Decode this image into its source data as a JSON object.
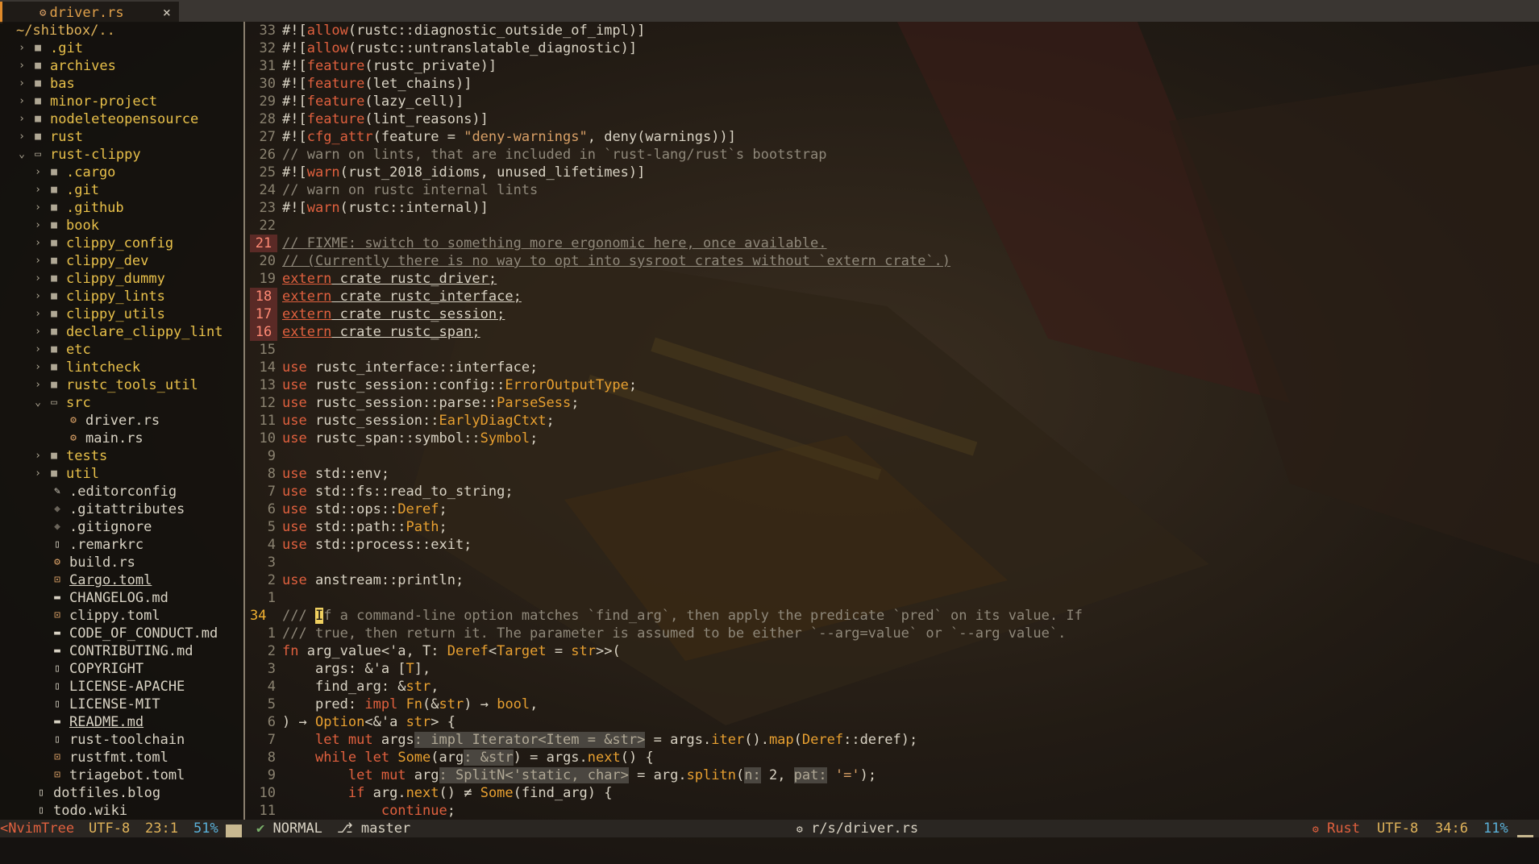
{
  "tab": {
    "icon": "rust-icon",
    "name": "driver.rs",
    "close": "×"
  },
  "tree": {
    "root": "~/shitbox/..",
    "items": [
      {
        "depth": 1,
        "type": "dir",
        "open": false,
        "name": ".git"
      },
      {
        "depth": 1,
        "type": "dir",
        "open": false,
        "name": "archives"
      },
      {
        "depth": 1,
        "type": "dir",
        "open": false,
        "name": "bas"
      },
      {
        "depth": 1,
        "type": "dir",
        "open": false,
        "name": "minor-project"
      },
      {
        "depth": 1,
        "type": "dir",
        "open": false,
        "name": "nodeleteopensource"
      },
      {
        "depth": 1,
        "type": "dir",
        "open": false,
        "name": "rust"
      },
      {
        "depth": 1,
        "type": "dir",
        "open": true,
        "name": "rust-clippy"
      },
      {
        "depth": 2,
        "type": "dir",
        "open": false,
        "name": ".cargo"
      },
      {
        "depth": 2,
        "type": "dir",
        "open": false,
        "name": ".git"
      },
      {
        "depth": 2,
        "type": "dir",
        "open": false,
        "name": ".github"
      },
      {
        "depth": 2,
        "type": "dir",
        "open": false,
        "name": "book"
      },
      {
        "depth": 2,
        "type": "dir",
        "open": false,
        "name": "clippy_config"
      },
      {
        "depth": 2,
        "type": "dir",
        "open": false,
        "name": "clippy_dev"
      },
      {
        "depth": 2,
        "type": "dir",
        "open": false,
        "name": "clippy_dummy"
      },
      {
        "depth": 2,
        "type": "dir",
        "open": false,
        "name": "clippy_lints"
      },
      {
        "depth": 2,
        "type": "dir",
        "open": false,
        "name": "clippy_utils"
      },
      {
        "depth": 2,
        "type": "dir",
        "open": false,
        "name": "declare_clippy_lint"
      },
      {
        "depth": 2,
        "type": "dir",
        "open": false,
        "name": "etc"
      },
      {
        "depth": 2,
        "type": "dir",
        "open": false,
        "name": "lintcheck"
      },
      {
        "depth": 2,
        "type": "dir",
        "open": false,
        "name": "rustc_tools_util"
      },
      {
        "depth": 2,
        "type": "dir",
        "open": true,
        "name": "src"
      },
      {
        "depth": 3,
        "type": "file",
        "icon": "rust",
        "name": "driver.rs"
      },
      {
        "depth": 3,
        "type": "file",
        "icon": "rust",
        "name": "main.rs"
      },
      {
        "depth": 2,
        "type": "dir",
        "open": false,
        "name": "tests"
      },
      {
        "depth": 2,
        "type": "dir",
        "open": false,
        "name": "util"
      },
      {
        "depth": 2,
        "type": "file",
        "icon": "editorconfig",
        "name": ".editorconfig"
      },
      {
        "depth": 2,
        "type": "file",
        "icon": "git",
        "name": ".gitattributes"
      },
      {
        "depth": 2,
        "type": "file",
        "icon": "git",
        "name": ".gitignore"
      },
      {
        "depth": 2,
        "type": "file",
        "icon": "doc",
        "name": ".remarkrc"
      },
      {
        "depth": 2,
        "type": "file",
        "icon": "rust",
        "name": "build.rs"
      },
      {
        "depth": 2,
        "type": "file",
        "icon": "toml",
        "name": "Cargo.toml",
        "underline": true
      },
      {
        "depth": 2,
        "type": "file",
        "icon": "md",
        "name": "CHANGELOG.md"
      },
      {
        "depth": 2,
        "type": "file",
        "icon": "toml",
        "name": "clippy.toml"
      },
      {
        "depth": 2,
        "type": "file",
        "icon": "md",
        "name": "CODE_OF_CONDUCT.md"
      },
      {
        "depth": 2,
        "type": "file",
        "icon": "md",
        "name": "CONTRIBUTING.md"
      },
      {
        "depth": 2,
        "type": "file",
        "icon": "doc",
        "name": "COPYRIGHT"
      },
      {
        "depth": 2,
        "type": "file",
        "icon": "doc",
        "name": "LICENSE-APACHE"
      },
      {
        "depth": 2,
        "type": "file",
        "icon": "doc",
        "name": "LICENSE-MIT"
      },
      {
        "depth": 2,
        "type": "file",
        "icon": "md",
        "name": "README.md",
        "underline": true
      },
      {
        "depth": 2,
        "type": "file",
        "icon": "doc",
        "name": "rust-toolchain"
      },
      {
        "depth": 2,
        "type": "file",
        "icon": "toml",
        "name": "rustfmt.toml"
      },
      {
        "depth": 2,
        "type": "file",
        "icon": "toml",
        "name": "triagebot.toml"
      },
      {
        "depth": 1,
        "type": "file",
        "icon": "doc",
        "name": "dotfiles.blog"
      },
      {
        "depth": 1,
        "type": "file",
        "icon": "doc",
        "name": "todo.wiki"
      }
    ]
  },
  "code": [
    {
      "ln": "33",
      "seg": [
        [
          "attr-hash",
          "#!["
        ],
        [
          "kw",
          "allow"
        ],
        [
          "",
          "(rustc::diagnostic_outside_of_impl)]"
        ]
      ]
    },
    {
      "ln": "32",
      "seg": [
        [
          "attr-hash",
          "#!["
        ],
        [
          "kw",
          "allow"
        ],
        [
          "",
          "(rustc::untranslatable_diagnostic)]"
        ]
      ]
    },
    {
      "ln": "31",
      "seg": [
        [
          "attr-hash",
          "#!["
        ],
        [
          "kw",
          "feature"
        ],
        [
          "",
          "(rustc_private)]"
        ]
      ]
    },
    {
      "ln": "30",
      "seg": [
        [
          "attr-hash",
          "#!["
        ],
        [
          "kw",
          "feature"
        ],
        [
          "",
          "(let_chains)]"
        ]
      ]
    },
    {
      "ln": "29",
      "seg": [
        [
          "attr-hash",
          "#!["
        ],
        [
          "kw",
          "feature"
        ],
        [
          "",
          "(lazy_cell)]"
        ]
      ]
    },
    {
      "ln": "28",
      "seg": [
        [
          "attr-hash",
          "#!["
        ],
        [
          "kw",
          "feature"
        ],
        [
          "",
          "(lint_reasons)]"
        ]
      ]
    },
    {
      "ln": "27",
      "seg": [
        [
          "attr-hash",
          "#!["
        ],
        [
          "kw",
          "cfg_attr"
        ],
        [
          "",
          "(feature = "
        ],
        [
          "str",
          "\"deny-warnings\""
        ],
        [
          "",
          ", deny(warnings))]"
        ]
      ]
    },
    {
      "ln": "26",
      "seg": [
        [
          "cm",
          "// warn on lints, that are included in `rust-lang/rust`s bootstrap"
        ]
      ]
    },
    {
      "ln": "25",
      "seg": [
        [
          "attr-hash",
          "#!["
        ],
        [
          "kw",
          "warn"
        ],
        [
          "",
          "(rust_2018_idioms, unused_lifetimes)]"
        ]
      ]
    },
    {
      "ln": "24",
      "seg": [
        [
          "cm",
          "// warn on rustc internal lints"
        ]
      ]
    },
    {
      "ln": "23",
      "seg": [
        [
          "attr-hash",
          "#!["
        ],
        [
          "kw",
          "warn"
        ],
        [
          "",
          "(rustc::internal)]"
        ]
      ]
    },
    {
      "ln": "22",
      "seg": []
    },
    {
      "ln": "21",
      "mark": true,
      "seg": [
        [
          "cm ul",
          "// FIXME: switch to something more ergonomic here, once available."
        ]
      ]
    },
    {
      "ln": "20",
      "seg": [
        [
          "cm ul",
          "// (Currently there is no way to opt into sysroot crates without `extern crate`.)"
        ]
      ]
    },
    {
      "ln": "19",
      "seg": [
        [
          "kw ul",
          "extern"
        ],
        [
          "ul",
          " crate rustc_driver;"
        ]
      ]
    },
    {
      "ln": "18",
      "mark": true,
      "seg": [
        [
          "kw ul",
          "extern"
        ],
        [
          "ul",
          " crate rustc_interface;"
        ]
      ]
    },
    {
      "ln": "17",
      "mark": true,
      "seg": [
        [
          "kw ul",
          "extern"
        ],
        [
          "ul",
          " crate rustc_session;"
        ]
      ]
    },
    {
      "ln": "16",
      "mark": true,
      "seg": [
        [
          "kw ul",
          "extern"
        ],
        [
          "ul",
          " crate rustc_span;"
        ]
      ]
    },
    {
      "ln": "15",
      "seg": []
    },
    {
      "ln": "14",
      "seg": [
        [
          "kw",
          "use"
        ],
        [
          "",
          " rustc_interface::interface;"
        ]
      ]
    },
    {
      "ln": "13",
      "seg": [
        [
          "kw",
          "use"
        ],
        [
          "",
          " rustc_session::config::"
        ],
        [
          "ty",
          "ErrorOutputType"
        ],
        [
          "",
          ";"
        ]
      ]
    },
    {
      "ln": "12",
      "seg": [
        [
          "kw",
          "use"
        ],
        [
          "",
          " rustc_session::parse::"
        ],
        [
          "ty",
          "ParseSess"
        ],
        [
          "",
          ";"
        ]
      ]
    },
    {
      "ln": "11",
      "seg": [
        [
          "kw",
          "use"
        ],
        [
          "",
          " rustc_session::"
        ],
        [
          "ty",
          "EarlyDiagCtxt"
        ],
        [
          "",
          ";"
        ]
      ]
    },
    {
      "ln": "10",
      "seg": [
        [
          "kw",
          "use"
        ],
        [
          "",
          " rustc_span::symbol::"
        ],
        [
          "ty",
          "Symbol"
        ],
        [
          "",
          ";"
        ]
      ]
    },
    {
      "ln": "9",
      "seg": []
    },
    {
      "ln": "8",
      "seg": [
        [
          "kw",
          "use"
        ],
        [
          "",
          " std::env;"
        ]
      ]
    },
    {
      "ln": "7",
      "seg": [
        [
          "kw",
          "use"
        ],
        [
          "",
          " std::fs::read_to_string;"
        ]
      ]
    },
    {
      "ln": "6",
      "seg": [
        [
          "kw",
          "use"
        ],
        [
          "",
          " std::ops::"
        ],
        [
          "ty",
          "Deref"
        ],
        [
          "",
          ";"
        ]
      ]
    },
    {
      "ln": "5",
      "seg": [
        [
          "kw",
          "use"
        ],
        [
          "",
          " std::path::"
        ],
        [
          "ty",
          "Path"
        ],
        [
          "",
          ";"
        ]
      ]
    },
    {
      "ln": "4",
      "seg": [
        [
          "kw",
          "use"
        ],
        [
          "",
          " std::process::exit;"
        ]
      ]
    },
    {
      "ln": "3",
      "seg": []
    },
    {
      "ln": "2",
      "seg": [
        [
          "kw",
          "use"
        ],
        [
          "",
          " anstream::println;"
        ]
      ]
    },
    {
      "ln": "1",
      "seg": []
    },
    {
      "ln": "34",
      "cur": true,
      "seg": [
        [
          "cm",
          "/// "
        ],
        [
          "cursor",
          "I"
        ],
        [
          "cm",
          "f a command-line option matches `find_arg`, then apply the predicate `pred` on its value. If"
        ]
      ]
    },
    {
      "ln": "1",
      "seg": [
        [
          "cm",
          "/// true, then return it. The parameter is assumed to be either `--arg=value` or `--arg value`."
        ]
      ]
    },
    {
      "ln": "2",
      "seg": [
        [
          "kw",
          "fn"
        ],
        [
          "",
          " arg_value<'a, T: "
        ],
        [
          "ty",
          "Deref"
        ],
        [
          "",
          "<"
        ],
        [
          "ty",
          "Target"
        ],
        [
          "",
          " = "
        ],
        [
          "ty",
          "str"
        ],
        [
          "",
          ">>("
        ]
      ]
    },
    {
      "ln": "3",
      "seg": [
        [
          "",
          "    args: &'a ["
        ],
        [
          "ty",
          "T"
        ],
        [
          "",
          "],"
        ]
      ]
    },
    {
      "ln": "4",
      "seg": [
        [
          "",
          "    find_arg: &"
        ],
        [
          "ty",
          "str"
        ],
        [
          "",
          ","
        ]
      ]
    },
    {
      "ln": "5",
      "seg": [
        [
          "",
          "    pred: "
        ],
        [
          "kw",
          "impl"
        ],
        [
          "",
          " "
        ],
        [
          "ty",
          "Fn"
        ],
        [
          "",
          "(&"
        ],
        [
          "ty",
          "str"
        ],
        [
          "",
          ") → "
        ],
        [
          "ty",
          "bool"
        ],
        [
          "",
          ","
        ]
      ]
    },
    {
      "ln": "6",
      "seg": [
        [
          "",
          ") → "
        ],
        [
          "ty",
          "Option"
        ],
        [
          "",
          "<&'a "
        ],
        [
          "ty",
          "str"
        ],
        [
          "",
          "> {"
        ]
      ]
    },
    {
      "ln": "7",
      "seg": [
        [
          "",
          "    "
        ],
        [
          "kw",
          "let mut"
        ],
        [
          "",
          " args"
        ],
        [
          "hint",
          ": impl Iterator<Item = &str>"
        ],
        [
          "",
          " = args."
        ],
        [
          "ty",
          "iter"
        ],
        [
          "",
          "()."
        ],
        [
          "ty",
          "map"
        ],
        [
          "",
          "("
        ],
        [
          "ty",
          "Deref"
        ],
        [
          "",
          "::deref);"
        ]
      ]
    },
    {
      "ln": "8",
      "seg": [
        [
          "",
          "    "
        ],
        [
          "kw",
          "while let"
        ],
        [
          "",
          " "
        ],
        [
          "ty",
          "Some"
        ],
        [
          "",
          "(arg"
        ],
        [
          "hint",
          ": &str"
        ],
        [
          "",
          ") = args."
        ],
        [
          "ty",
          "next"
        ],
        [
          "",
          "() {"
        ]
      ]
    },
    {
      "ln": "9",
      "seg": [
        [
          "",
          "        "
        ],
        [
          "kw",
          "let mut"
        ],
        [
          "",
          " arg"
        ],
        [
          "hint",
          ": SplitN<'static, char>"
        ],
        [
          "",
          " = arg."
        ],
        [
          "ty",
          "splitn"
        ],
        [
          "",
          "("
        ],
        [
          "hint",
          "n:"
        ],
        [
          "",
          " 2, "
        ],
        [
          "hint",
          "pat:"
        ],
        [
          "",
          " "
        ],
        [
          "str",
          "'='"
        ],
        [
          "",
          ");"
        ]
      ]
    },
    {
      "ln": "10",
      "seg": [
        [
          "",
          "        "
        ],
        [
          "kw",
          "if"
        ],
        [
          "",
          " arg."
        ],
        [
          "ty",
          "next"
        ],
        [
          "",
          "() ≠ "
        ],
        [
          "ty",
          "Some"
        ],
        [
          "",
          "(find_arg) {"
        ]
      ]
    },
    {
      "ln": "11",
      "seg": [
        [
          "",
          "            "
        ],
        [
          "kw",
          "continue"
        ],
        [
          "",
          ";"
        ]
      ]
    }
  ],
  "status": {
    "tree_label": "<NvimTree",
    "tree_enc": "UTF-8",
    "tree_pos": "23:1",
    "tree_pct": "51%",
    "mode": "NORMAL",
    "branch": "master",
    "file": "r/s/driver.rs",
    "lang": "Rust",
    "enc": "UTF-8",
    "pos": "34:6",
    "pct": "11%"
  }
}
